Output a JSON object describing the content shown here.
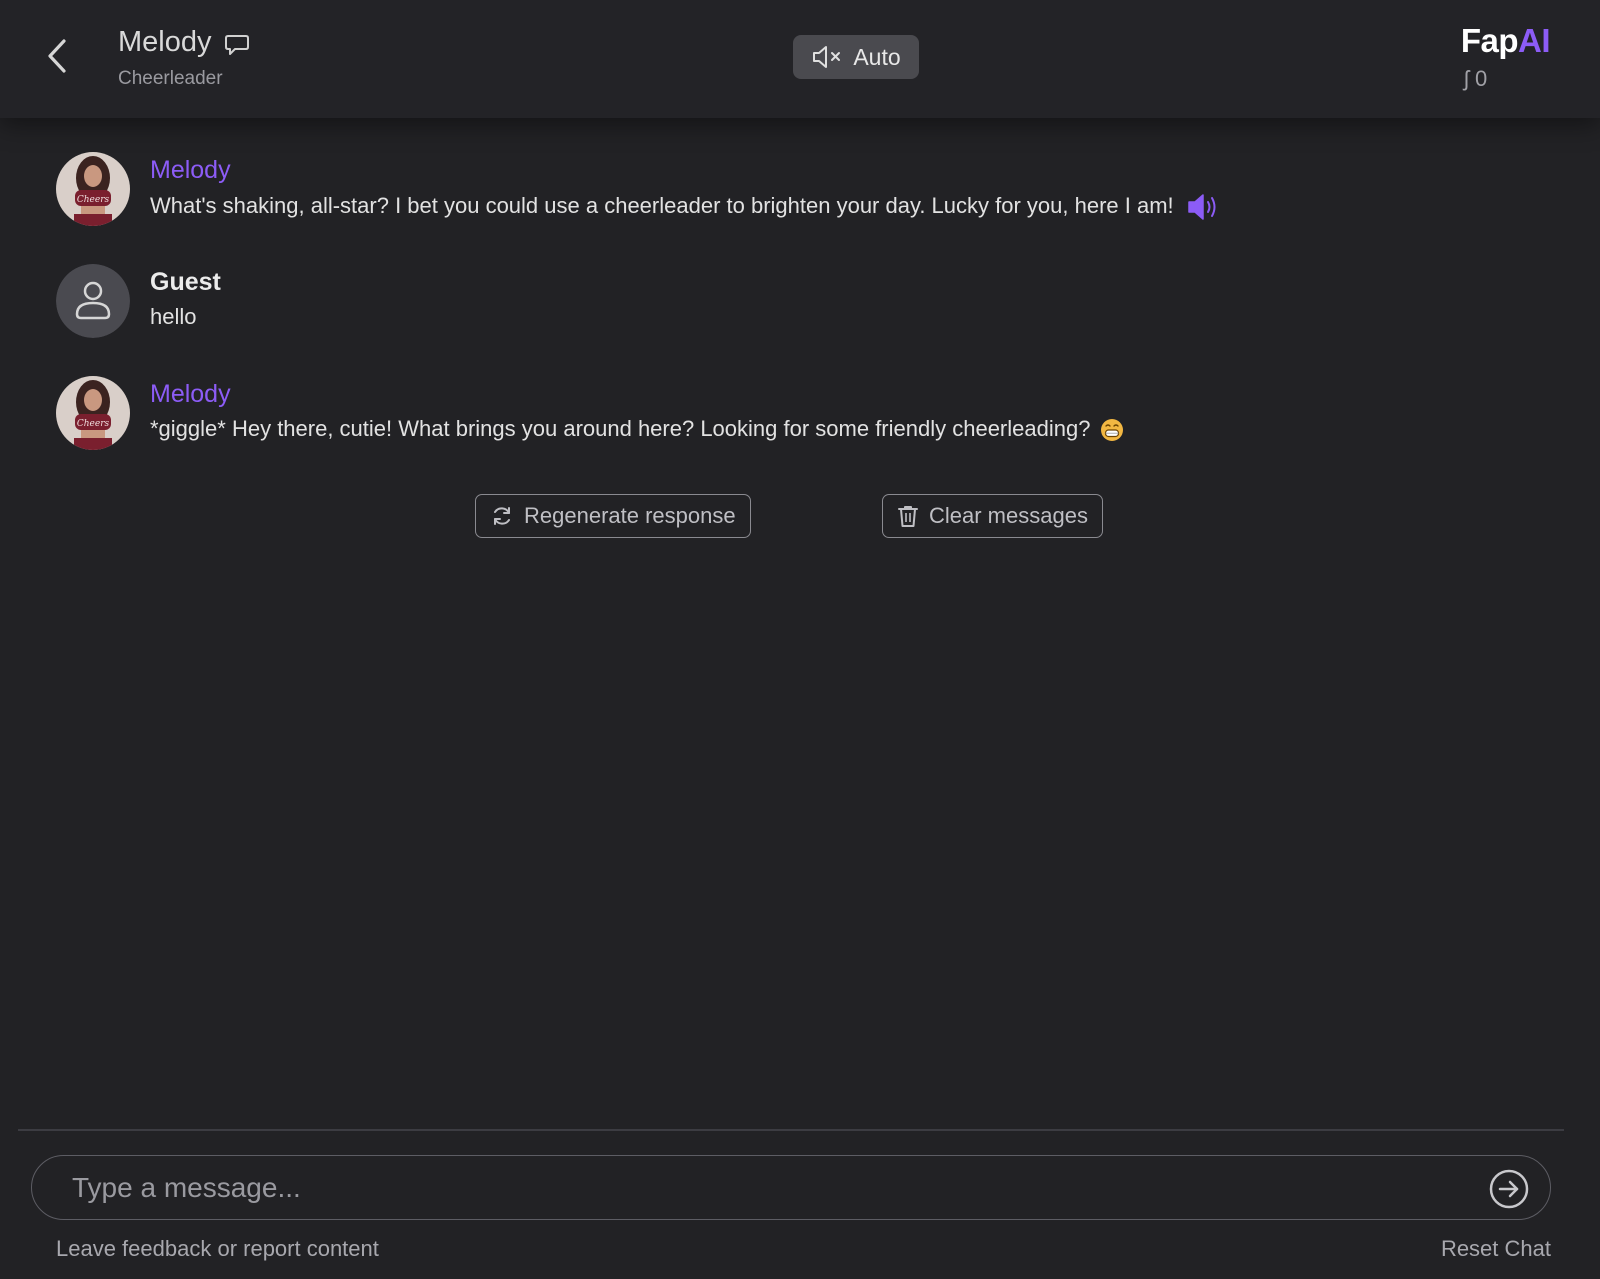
{
  "header": {
    "character_name": "Melody",
    "character_role": "Cheerleader",
    "auto_label": "Auto",
    "brand_main": "Fap",
    "brand_accent": "AI",
    "credits": "ʃ 0"
  },
  "messages": [
    {
      "sender": "Melody",
      "role": "bot",
      "text": "What's shaking, all-star? I bet you could use a cheerleader to brighten your day. Lucky for you, here I am!",
      "icon": "speaker-icon"
    },
    {
      "sender": "Guest",
      "role": "user",
      "text": "hello"
    },
    {
      "sender": "Melody",
      "role": "bot",
      "text": "*giggle* Hey there, cutie! What brings you around here? Looking for some friendly cheerleading?",
      "icon": "grinning-emoji-icon"
    }
  ],
  "actions": {
    "regenerate_label": "Regenerate response",
    "clear_label": "Clear messages"
  },
  "composer": {
    "placeholder": "Type a message...",
    "value": ""
  },
  "footer": {
    "feedback_label": "Leave feedback or report content",
    "reset_label": "Reset Chat"
  },
  "colors": {
    "accent": "#8c5cf6",
    "background": "#222225",
    "header": "#232327"
  }
}
